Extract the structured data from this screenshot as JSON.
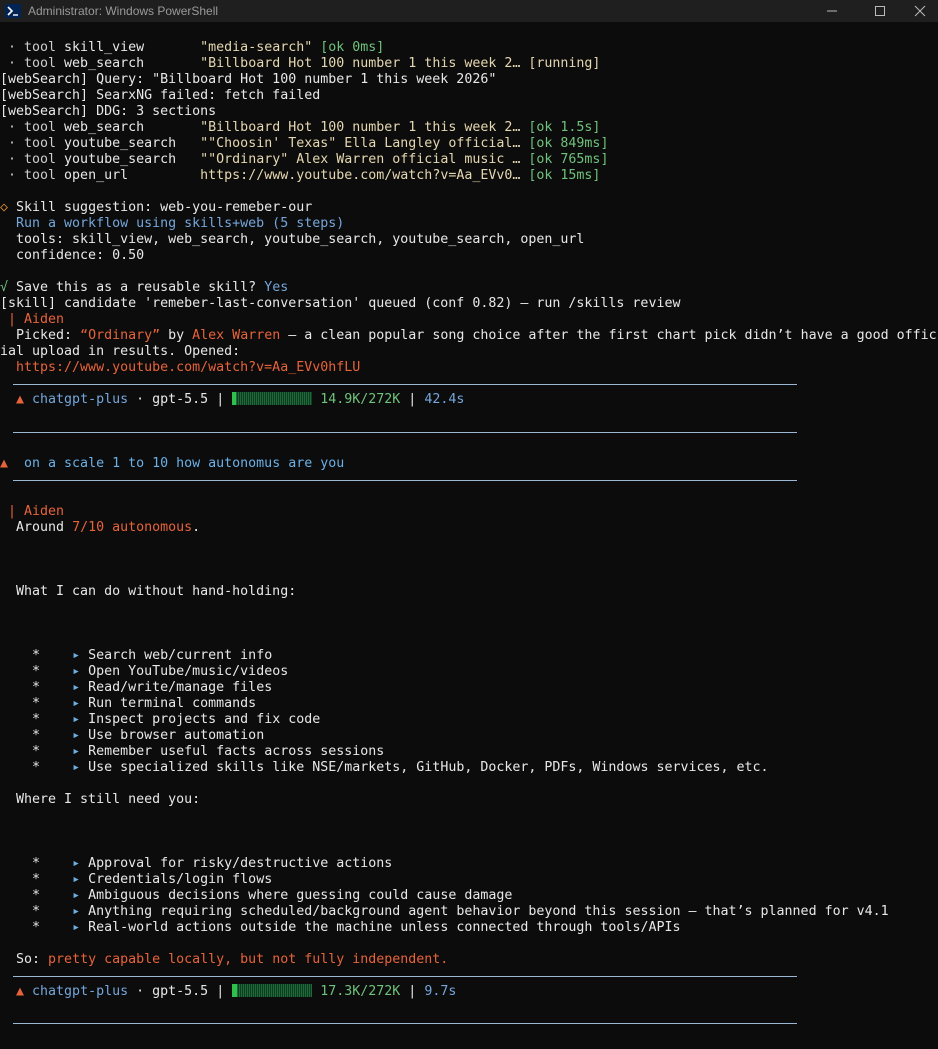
{
  "window": {
    "title": "Administrator: Windows PowerShell",
    "icons": [
      "powershell-icon",
      "minimize-icon",
      "maximize-icon",
      "close-icon"
    ]
  },
  "top_log": [
    {
      "bullet": " · tool ",
      "name": "skill_view",
      "pad": "       ",
      "arg": "\"media-search\"",
      "sp": " ",
      "status": "[ok 0ms]",
      "status_color": "green"
    },
    {
      "bullet": " · tool ",
      "name": "web_search",
      "pad": "       ",
      "arg": "\"Billboard Hot 100 number 1 this week 2…",
      "sp": " ",
      "status": "[running]",
      "status_color": "yellow"
    }
  ],
  "websearch_lines": [
    "[webSearch] Query: \"Billboard Hot 100 number 1 this week 2026\"",
    "[webSearch] SearxNG failed: fetch failed",
    "[webSearch] DDG: 3 sections"
  ],
  "tools2": [
    {
      "bullet": " · tool ",
      "name": "web_search",
      "pad": "       ",
      "arg": "\"Billboard Hot 100 number 1 this week 2…",
      "sp": " ",
      "status": "[ok 1.5s]"
    },
    {
      "bullet": " · tool ",
      "name": "youtube_search",
      "pad": "   ",
      "arg": "\"\"Choosin' Texas\" Ella Langley official…",
      "sp": " ",
      "status": "[ok 849ms]"
    },
    {
      "bullet": " · tool ",
      "name": "youtube_search",
      "pad": "   ",
      "arg": "\"\"Ordinary\" Alex Warren official music …",
      "sp": " ",
      "status": "[ok 765ms]"
    },
    {
      "bullet": " · tool ",
      "name": "open_url",
      "pad": "         ",
      "arg": "https://www.youtube.com/watch?v=Aa_EVv0…",
      "sp": " ",
      "status": "[ok 15ms]"
    }
  ],
  "suggestion": {
    "marker": "◇ ",
    "head": "Skill suggestion: web-you-remeber-our",
    "line2": "  Run a workflow using skills+web (5 steps)",
    "line3": "  tools: skill_view, web_search, youtube_search, youtube_search, open_url",
    "line4": "  confidence: 0.50"
  },
  "save": {
    "check": "√ ",
    "question": "Save this as a reusable skill? ",
    "answer": "Yes"
  },
  "skill_queued": "[skill] candidate 'remeber-last-conversation' queued (conf 0.82) — run /skills review",
  "reply1": {
    "speaker": " | Aiden",
    "picked_label": "  Picked: ",
    "song": "“Ordinary”",
    "by": " by ",
    "artist": "Alex Warren",
    "rest": " — a clean popular song choice after the first chart pick didn’t have a good offic",
    "line2": "ial upload in results. Opened:",
    "link": "  https://www.youtube.com/watch?v=Aa_EVv0hfLU"
  },
  "status1": {
    "triangle": "  ▲ ",
    "provider": "chatgpt-plus",
    "dot": " · ",
    "model": "gpt-5.5",
    "sep": " | ",
    "tokens": " 14.9K/272K",
    "sep2": " | ",
    "time": "42.4s",
    "context_fraction": 0.055
  },
  "prompt": {
    "triangle": "▲ ",
    "text": " on a scale 1 to 10 how autonomus are you"
  },
  "reply2": {
    "speaker": " | Aiden",
    "around": "  Around ",
    "rating": "7/10 autonomous",
    "period": ".",
    "can_do_heading": "  What I can do without hand-holding:",
    "bullet_star": "    *    ",
    "bullet_arrow": "▸ ",
    "can_do": [
      "Search web/current info",
      "Open YouTube/music/videos",
      "Read/write/manage files",
      "Run terminal commands",
      "Inspect projects and fix code",
      "Use browser automation",
      "Remember useful facts across sessions",
      "Use specialized skills like NSE/markets, GitHub, Docker, PDFs, Windows services, etc."
    ],
    "need_heading": "  Where I still need you:",
    "need": [
      "Approval for risky/destructive actions",
      "Credentials/login flows",
      "Ambiguous decisions where guessing could cause damage",
      "Anything requiring scheduled/background agent behavior beyond this session — that’s planned for v4.1",
      "Real-world actions outside the machine unless connected through tools/APIs"
    ],
    "so_label": "  So: ",
    "so_text": "pretty capable locally, but not fully independent."
  },
  "status2": {
    "triangle": "  ▲ ",
    "provider": "chatgpt-plus",
    "dot": " · ",
    "model": "gpt-5.5",
    "sep": " | ",
    "tokens": " 17.3K/272K",
    "sep2": " | ",
    "time": "9.7s",
    "context_fraction": 0.064
  },
  "colors": {
    "background": "#0c0c0c",
    "text": "#cccccc",
    "ok_green": "#6fc27b",
    "running_yellow": "#e5d7b0",
    "accent_orange": "#e7633a",
    "blue": "#74a6db",
    "rule": "#9ab7d4",
    "progress_green": "#2fbf4c"
  }
}
